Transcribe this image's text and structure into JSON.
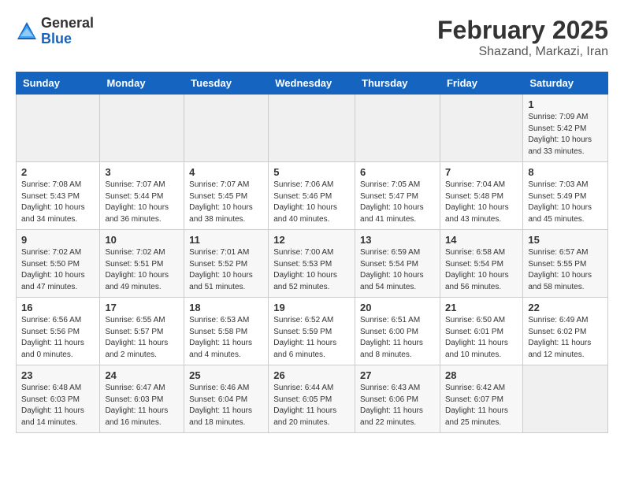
{
  "header": {
    "logo_general": "General",
    "logo_blue": "Blue",
    "month_year": "February 2025",
    "location": "Shazand, Markazi, Iran"
  },
  "weekdays": [
    "Sunday",
    "Monday",
    "Tuesday",
    "Wednesday",
    "Thursday",
    "Friday",
    "Saturday"
  ],
  "weeks": [
    [
      {
        "day": "",
        "info": ""
      },
      {
        "day": "",
        "info": ""
      },
      {
        "day": "",
        "info": ""
      },
      {
        "day": "",
        "info": ""
      },
      {
        "day": "",
        "info": ""
      },
      {
        "day": "",
        "info": ""
      },
      {
        "day": "1",
        "info": "Sunrise: 7:09 AM\nSunset: 5:42 PM\nDaylight: 10 hours\nand 33 minutes."
      }
    ],
    [
      {
        "day": "2",
        "info": "Sunrise: 7:08 AM\nSunset: 5:43 PM\nDaylight: 10 hours\nand 34 minutes."
      },
      {
        "day": "3",
        "info": "Sunrise: 7:07 AM\nSunset: 5:44 PM\nDaylight: 10 hours\nand 36 minutes."
      },
      {
        "day": "4",
        "info": "Sunrise: 7:07 AM\nSunset: 5:45 PM\nDaylight: 10 hours\nand 38 minutes."
      },
      {
        "day": "5",
        "info": "Sunrise: 7:06 AM\nSunset: 5:46 PM\nDaylight: 10 hours\nand 40 minutes."
      },
      {
        "day": "6",
        "info": "Sunrise: 7:05 AM\nSunset: 5:47 PM\nDaylight: 10 hours\nand 41 minutes."
      },
      {
        "day": "7",
        "info": "Sunrise: 7:04 AM\nSunset: 5:48 PM\nDaylight: 10 hours\nand 43 minutes."
      },
      {
        "day": "8",
        "info": "Sunrise: 7:03 AM\nSunset: 5:49 PM\nDaylight: 10 hours\nand 45 minutes."
      }
    ],
    [
      {
        "day": "9",
        "info": "Sunrise: 7:02 AM\nSunset: 5:50 PM\nDaylight: 10 hours\nand 47 minutes."
      },
      {
        "day": "10",
        "info": "Sunrise: 7:02 AM\nSunset: 5:51 PM\nDaylight: 10 hours\nand 49 minutes."
      },
      {
        "day": "11",
        "info": "Sunrise: 7:01 AM\nSunset: 5:52 PM\nDaylight: 10 hours\nand 51 minutes."
      },
      {
        "day": "12",
        "info": "Sunrise: 7:00 AM\nSunset: 5:53 PM\nDaylight: 10 hours\nand 52 minutes."
      },
      {
        "day": "13",
        "info": "Sunrise: 6:59 AM\nSunset: 5:54 PM\nDaylight: 10 hours\nand 54 minutes."
      },
      {
        "day": "14",
        "info": "Sunrise: 6:58 AM\nSunset: 5:54 PM\nDaylight: 10 hours\nand 56 minutes."
      },
      {
        "day": "15",
        "info": "Sunrise: 6:57 AM\nSunset: 5:55 PM\nDaylight: 10 hours\nand 58 minutes."
      }
    ],
    [
      {
        "day": "16",
        "info": "Sunrise: 6:56 AM\nSunset: 5:56 PM\nDaylight: 11 hours\nand 0 minutes."
      },
      {
        "day": "17",
        "info": "Sunrise: 6:55 AM\nSunset: 5:57 PM\nDaylight: 11 hours\nand 2 minutes."
      },
      {
        "day": "18",
        "info": "Sunrise: 6:53 AM\nSunset: 5:58 PM\nDaylight: 11 hours\nand 4 minutes."
      },
      {
        "day": "19",
        "info": "Sunrise: 6:52 AM\nSunset: 5:59 PM\nDaylight: 11 hours\nand 6 minutes."
      },
      {
        "day": "20",
        "info": "Sunrise: 6:51 AM\nSunset: 6:00 PM\nDaylight: 11 hours\nand 8 minutes."
      },
      {
        "day": "21",
        "info": "Sunrise: 6:50 AM\nSunset: 6:01 PM\nDaylight: 11 hours\nand 10 minutes."
      },
      {
        "day": "22",
        "info": "Sunrise: 6:49 AM\nSunset: 6:02 PM\nDaylight: 11 hours\nand 12 minutes."
      }
    ],
    [
      {
        "day": "23",
        "info": "Sunrise: 6:48 AM\nSunset: 6:03 PM\nDaylight: 11 hours\nand 14 minutes."
      },
      {
        "day": "24",
        "info": "Sunrise: 6:47 AM\nSunset: 6:03 PM\nDaylight: 11 hours\nand 16 minutes."
      },
      {
        "day": "25",
        "info": "Sunrise: 6:46 AM\nSunset: 6:04 PM\nDaylight: 11 hours\nand 18 minutes."
      },
      {
        "day": "26",
        "info": "Sunrise: 6:44 AM\nSunset: 6:05 PM\nDaylight: 11 hours\nand 20 minutes."
      },
      {
        "day": "27",
        "info": "Sunrise: 6:43 AM\nSunset: 6:06 PM\nDaylight: 11 hours\nand 22 minutes."
      },
      {
        "day": "28",
        "info": "Sunrise: 6:42 AM\nSunset: 6:07 PM\nDaylight: 11 hours\nand 25 minutes."
      },
      {
        "day": "",
        "info": ""
      }
    ]
  ]
}
